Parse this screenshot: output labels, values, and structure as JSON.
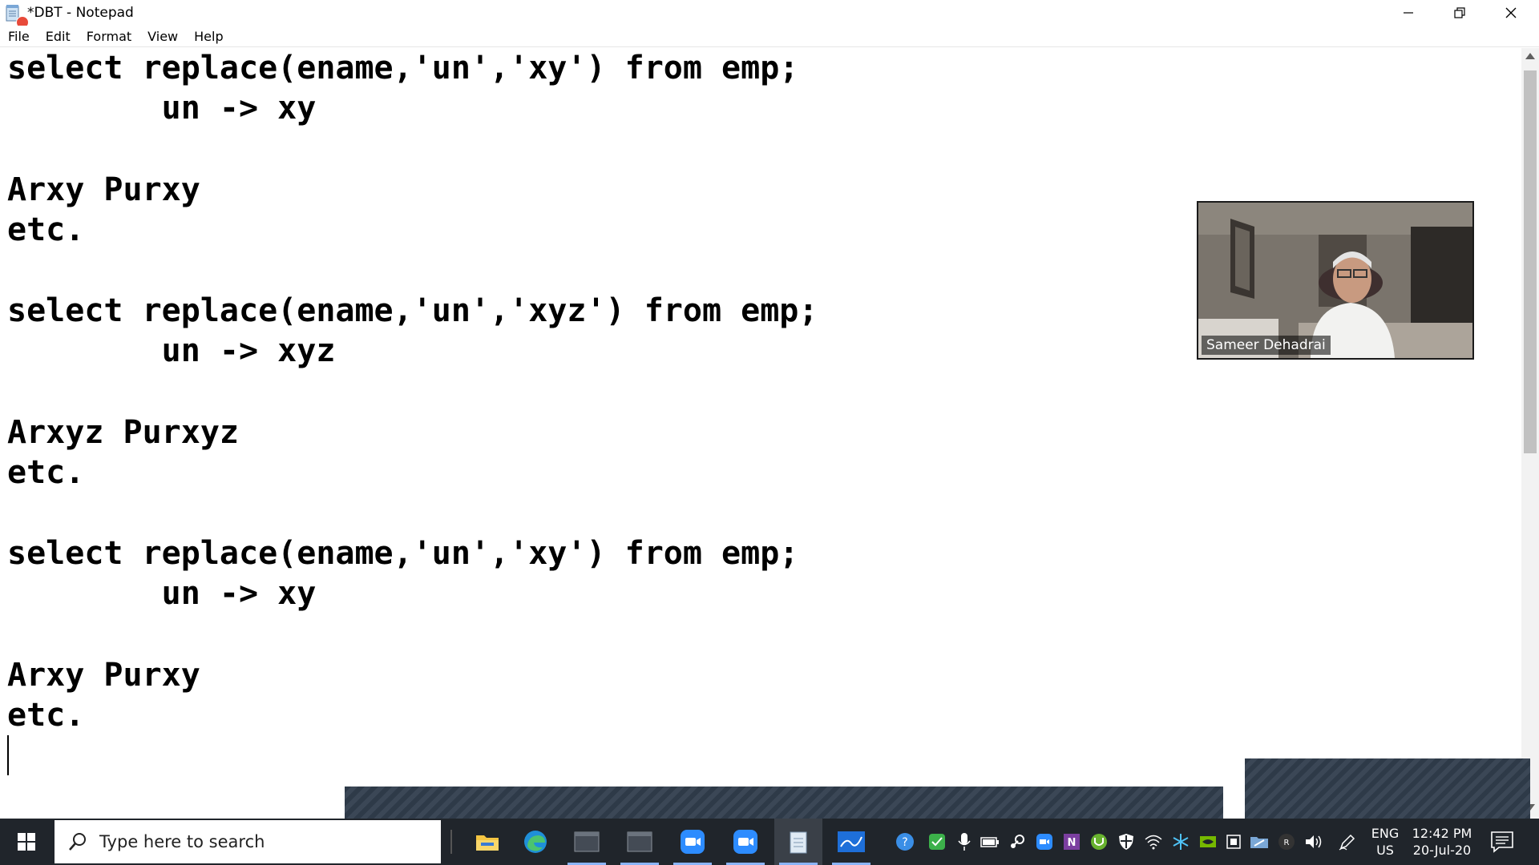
{
  "window": {
    "title": "*DBT - Notepad"
  },
  "menu": {
    "file": "File",
    "edit": "Edit",
    "format": "Format",
    "view": "View",
    "help": "Help"
  },
  "editor": {
    "lines": [
      "select replace(ename,'un','xy') from emp;",
      "        un -> xy",
      "",
      "Arxy Purxy",
      "etc.",
      "",
      "select replace(ename,'un','xyz') from emp;",
      "        un -> xyz",
      "",
      "Arxyz Purxyz",
      "etc.",
      "",
      "select replace(ename,'un','xy') from emp;",
      "        un -> xy",
      "",
      "Arxy Purxy",
      "etc."
    ]
  },
  "webcam": {
    "participant_name": "Sameer Dehadrai"
  },
  "taskbar": {
    "search_placeholder": "Type here to search",
    "apps": [
      "file-explorer",
      "edge",
      "terminal-1",
      "terminal-2",
      "zoom-1",
      "zoom-2",
      "notepad",
      "whiteboard"
    ],
    "language_line1": "ENG",
    "language_line2": "US",
    "time": "12:42 PM",
    "date": "20-Jul-20"
  },
  "colors": {
    "taskbar_bg": "#20252b",
    "recording_dot": "#e84a3a",
    "editor_text": "#000000"
  }
}
